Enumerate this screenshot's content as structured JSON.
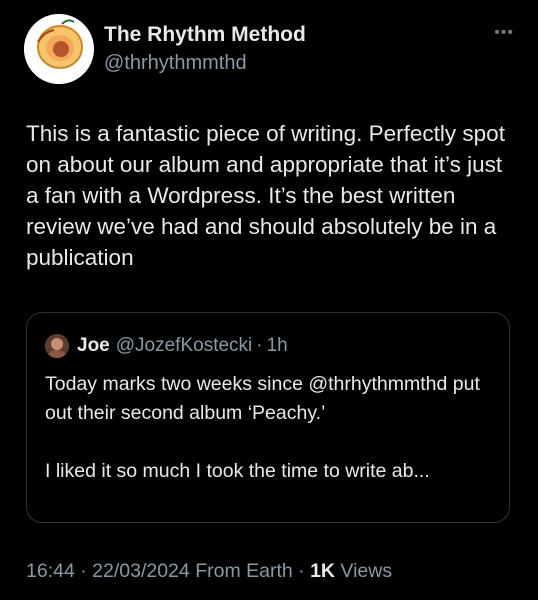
{
  "author": {
    "display_name": "The Rhythm Method",
    "handle": "@thrhythmmthd",
    "avatar_caption": "PEACHY"
  },
  "more_icon": "ellipsis-icon",
  "tweet": {
    "text": "This is a fantastic piece of writing. Perfectly spot on about our album and appropriate that it’s just a fan with a Wordpress. It’s the best written review we’ve had and should absolutely be in a publication"
  },
  "quote": {
    "name": "Joe",
    "handle": "@JozefKostecki",
    "separator": "·",
    "time": "1h",
    "paragraph1": "Today marks two weeks since @thrhythmmthd put out their second album ‘Peachy.’",
    "paragraph2": "I liked it so much I took the time to write ab..."
  },
  "meta": {
    "time": "16:44",
    "date": "22/03/2024",
    "location": "From Earth",
    "views_count": "1K",
    "views_label": "Views"
  },
  "colors": {
    "background": "#000000",
    "text": "#e7e9ea",
    "secondary": "#8b98a5",
    "border": "#2f3336"
  }
}
